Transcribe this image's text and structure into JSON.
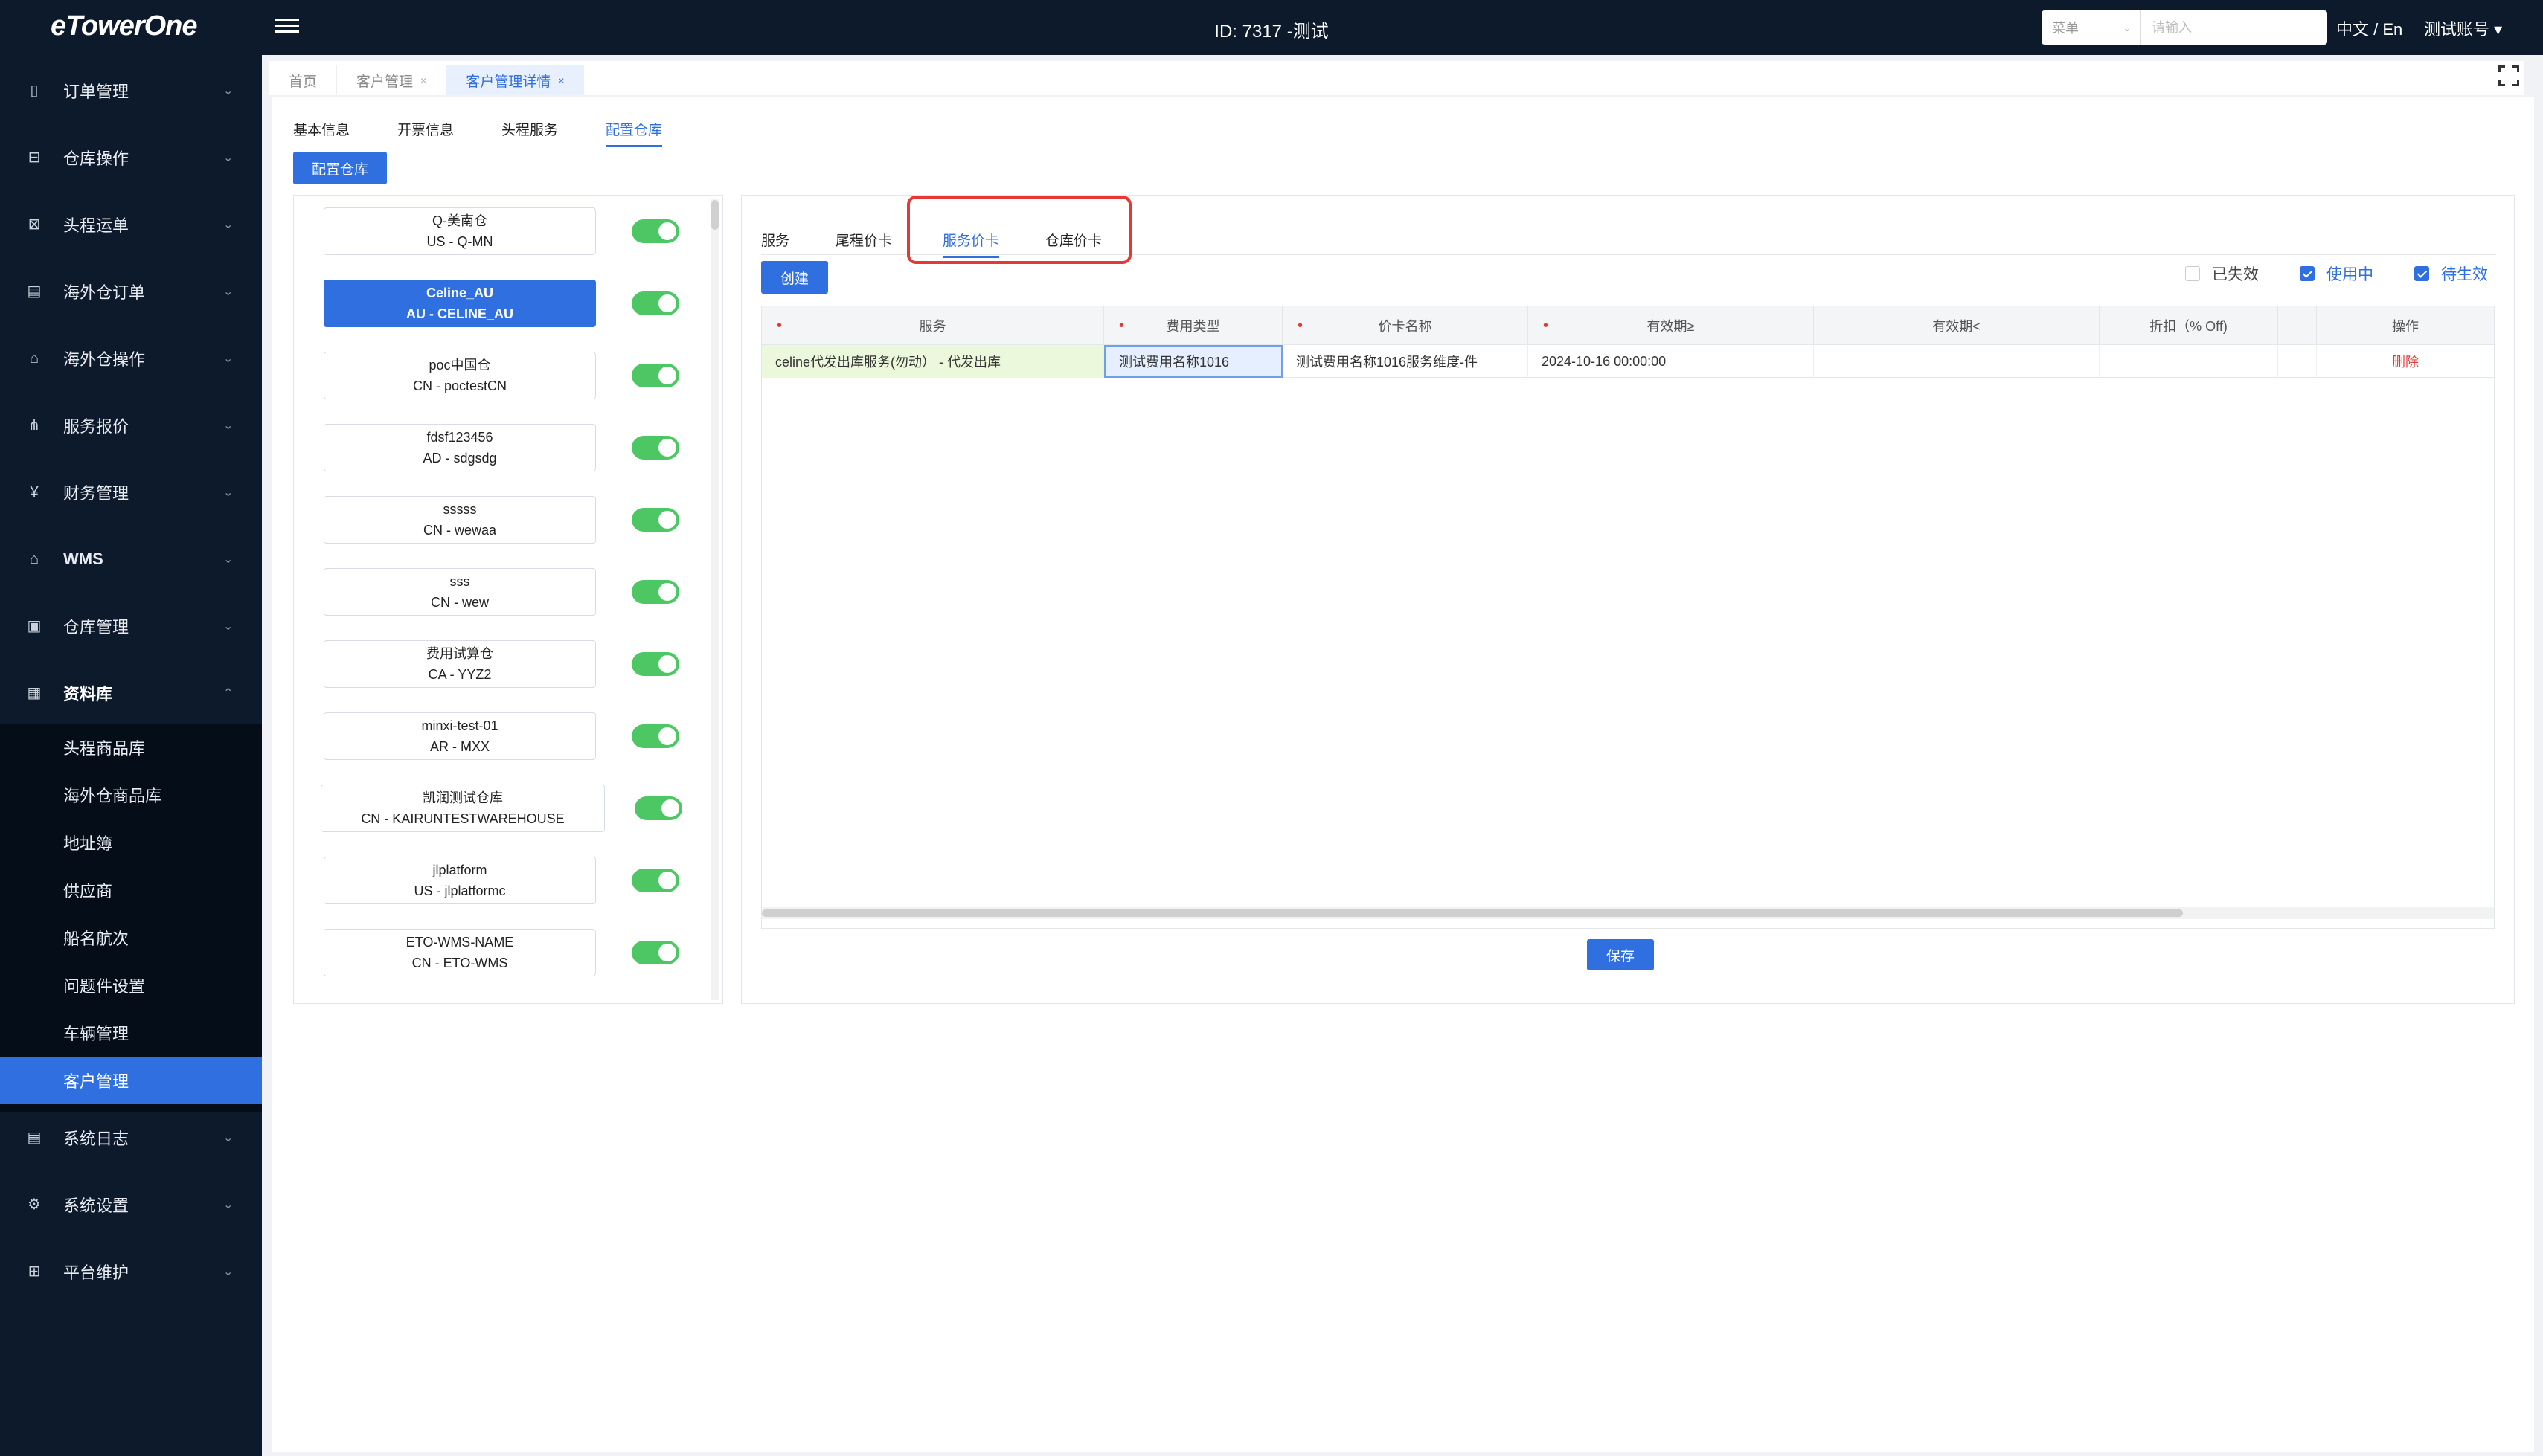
{
  "app": {
    "logo": "eTowerOne",
    "title": "ID: 7317 -测试",
    "search": {
      "select_label": "菜单",
      "placeholder": "请输入"
    },
    "language": "中文 / En",
    "account": "测试账号 ▾"
  },
  "sidebar": {
    "items": [
      {
        "label": "订单管理",
        "icon": "document-icon"
      },
      {
        "label": "仓库操作",
        "icon": "warehouse-icon"
      },
      {
        "label": "头程运单",
        "icon": "shipment-icon"
      },
      {
        "label": "海外仓订单",
        "icon": "order-icon"
      },
      {
        "label": "海外仓操作",
        "icon": "operation-icon"
      },
      {
        "label": "服务报价",
        "icon": "quote-icon"
      },
      {
        "label": "财务管理",
        "icon": "finance-icon"
      },
      {
        "label": "WMS",
        "icon": "wms-icon"
      },
      {
        "label": "仓库管理",
        "icon": "building-icon"
      },
      {
        "label": "资料库",
        "icon": "library-icon"
      }
    ],
    "sub_items": [
      {
        "label": "头程商品库"
      },
      {
        "label": "海外仓商品库"
      },
      {
        "label": "地址簿"
      },
      {
        "label": "供应商"
      },
      {
        "label": "船名航次"
      },
      {
        "label": "问题件设置"
      },
      {
        "label": "车辆管理"
      },
      {
        "label": "客户管理"
      }
    ],
    "bottom_items": [
      {
        "label": "系统日志",
        "icon": "log-icon"
      },
      {
        "label": "系统设置",
        "icon": "settings-icon"
      },
      {
        "label": "平台维护",
        "icon": "platform-icon"
      }
    ]
  },
  "page_tabs": [
    {
      "label": "首页"
    },
    {
      "label": "客户管理",
      "close": "×"
    },
    {
      "label": "客户管理详情",
      "close": "×"
    }
  ],
  "sub_tabs": [
    "基本信息",
    "开票信息",
    "头程服务",
    "配置仓库"
  ],
  "config_button": "配置仓库",
  "warehouses": [
    {
      "name": "Q-美南仓",
      "code": "US - Q-MN",
      "enabled": true
    },
    {
      "name": "Celine_AU",
      "code": "AU - CELINE_AU",
      "enabled": true
    },
    {
      "name": "poc中国仓",
      "code": "CN - poctestCN",
      "enabled": true
    },
    {
      "name": "fdsf123456",
      "code": "AD - sdgsdg",
      "enabled": true
    },
    {
      "name": "sssss",
      "code": "CN - wewaa",
      "enabled": true
    },
    {
      "name": "sss",
      "code": "CN - wew",
      "enabled": true
    },
    {
      "name": "费用试算仓",
      "code": "CA - YYZ2",
      "enabled": true
    },
    {
      "name": "minxi-test-01",
      "code": "AR - MXX",
      "enabled": true
    },
    {
      "name": "凯润测试仓库",
      "code": "CN - KAIRUNTESTWAREHOUSE",
      "enabled": true
    },
    {
      "name": "jlplatform",
      "code": "US - jlplatformc",
      "enabled": true
    },
    {
      "name": "ETO-WMS-NAME",
      "code": "CN - ETO-WMS",
      "enabled": true
    }
  ],
  "right_tabs": [
    "服务",
    "尾程价卡",
    "服务价卡",
    "仓库价卡"
  ],
  "create_button": "创建",
  "filters": [
    {
      "label": "已失效",
      "checked": false
    },
    {
      "label": "使用中",
      "checked": true
    },
    {
      "label": "待生效",
      "checked": true
    }
  ],
  "table": {
    "headers": [
      "服务",
      "费用类型",
      "价卡名称",
      "有效期≥",
      "有效期<",
      "折扣（% Off)",
      "",
      "操作"
    ],
    "required_mark": "•",
    "rows": [
      {
        "service": "celine代发出库服务(勿动） - 代发出库",
        "fee_type": "测试费用名称1016",
        "card_name": "测试费用名称1016服务维度-件",
        "valid_from": "2024-10-16 00:00:00",
        "valid_to": "",
        "discount": "",
        "extra": "",
        "action": "删除"
      }
    ]
  },
  "save_button": "保存",
  "colors": {
    "accent": "#2f6fe0",
    "sidebar": "#0d1a2b",
    "toggle_on": "#4cc764",
    "danger": "#e53935"
  }
}
